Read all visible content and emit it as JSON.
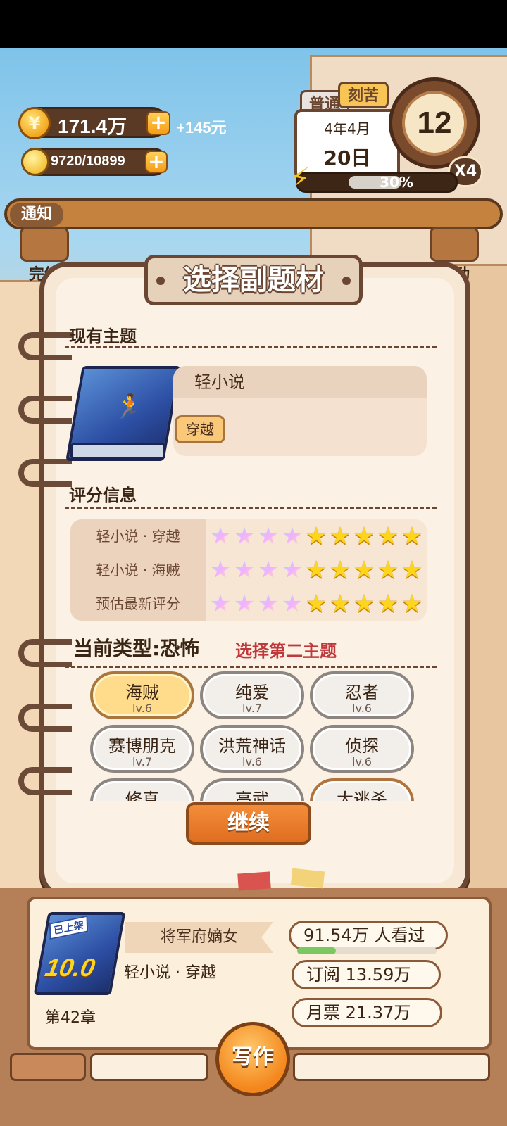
{
  "hud": {
    "coins": "171.4万",
    "cash": "+145元",
    "inspiration": "9720/10899",
    "tag_normal": "普通",
    "tag_hard": "刻苦",
    "month": "4年4月",
    "day": "20日",
    "clock_value": "12",
    "multiplier": "X4",
    "energy_percent": "30%",
    "energy_fraction": 0.3
  },
  "notice": {
    "label": "通知"
  },
  "side": {
    "left_top": "完结",
    "right_top": "行动"
  },
  "dialog": {
    "title": "选择副题材",
    "current_theme_heading": "现有主题",
    "theme_name": "轻小说",
    "theme_tag": "穿越",
    "rating_heading": "评分信息",
    "ratings": [
      {
        "label": "轻小说 · 穿越",
        "rainbow": 4,
        "gold": 5
      },
      {
        "label": "轻小说 · 海贼",
        "rainbow": 4,
        "gold": 5
      },
      {
        "label": "预估最新评分",
        "rainbow": 4,
        "gold": 5
      }
    ],
    "current_type": "当前类型:恐怖",
    "select_second": "选择第二主题",
    "genres": [
      {
        "name": "海贼",
        "lv": "lv.6",
        "selected": true
      },
      {
        "name": "纯爱",
        "lv": "lv.7"
      },
      {
        "name": "忍者",
        "lv": "lv.6"
      },
      {
        "name": "赛博朋克",
        "lv": "lv.7"
      },
      {
        "name": "洪荒神话",
        "lv": "lv.6"
      },
      {
        "name": "侦探",
        "lv": "lv.6"
      },
      {
        "name": "修真",
        "lv": ""
      },
      {
        "name": "高武",
        "lv": ""
      },
      {
        "name": "大逃杀",
        "lv": ""
      }
    ],
    "continue_label": "继续"
  },
  "bottom": {
    "book_badge": "已上架",
    "book_score": "10.0",
    "chapter": "第42章",
    "book_title": "将军府嫡女",
    "book_genre": "轻小说 · 穿越",
    "views": "91.54万 人看过",
    "views_progress": 0.28,
    "subs": "订阅 13.59万",
    "tickets": "月票 21.37万",
    "write_label": "写作"
  },
  "colors": {
    "accent": "#e06e20",
    "frame": "#6b4632",
    "highlight_red": "#c0383b"
  }
}
